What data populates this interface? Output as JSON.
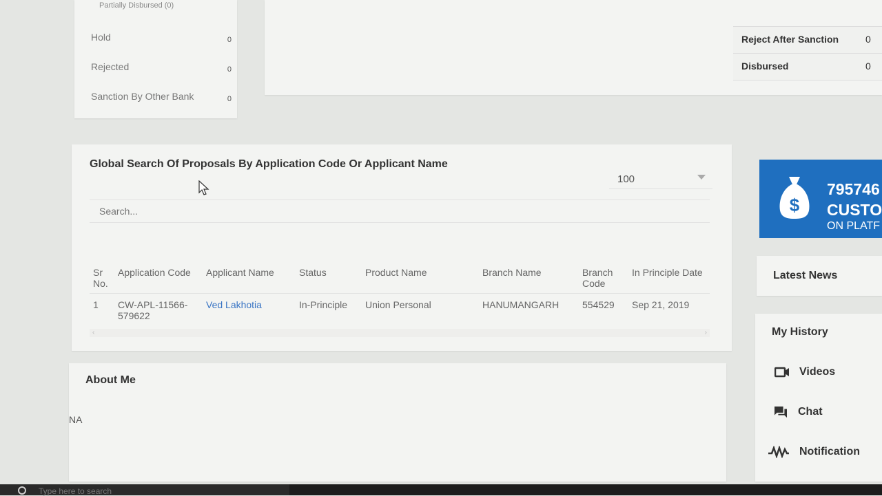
{
  "status_panel": {
    "partially_disbursed": "Partially Disbursed (0)",
    "items": [
      {
        "label": "Hold",
        "count": "0"
      },
      {
        "label": "Rejected",
        "count": "0"
      },
      {
        "label": "Sanction By Other Bank",
        "count": "0"
      }
    ]
  },
  "right_panel": {
    "rows": [
      {
        "label": "Reject After Sanction",
        "value": "0"
      },
      {
        "label": "Disbursed",
        "value": "0"
      }
    ]
  },
  "search_section": {
    "title": "Global Search Of Proposals By Application Code Or Applicant Name",
    "page_size": "100",
    "search_placeholder": "Search...",
    "columns": [
      "Sr No.",
      "Application Code",
      "Applicant Name",
      "Status",
      "Product Name",
      "Branch Name",
      "Branch Code",
      "In Principle Date"
    ],
    "rows": [
      {
        "sr": "1",
        "application_code": "CW-APL-11566-579622",
        "applicant_name": "Ved Lakhotia",
        "status": "In-Principle",
        "product_name": "Union Personal",
        "branch_name": "HANUMANGARH",
        "branch_code": "554529",
        "in_principle_date": "Sep 21, 2019"
      }
    ]
  },
  "about": {
    "title": "About Me",
    "body": "NA"
  },
  "banner": {
    "number": "795746",
    "line1": "CUSTO",
    "line2": "ON PLATF"
  },
  "sidebar": {
    "latest_news": "Latest News",
    "my_history": "My History",
    "items": [
      {
        "label": "Videos",
        "icon": "video-camera-icon"
      },
      {
        "label": "Chat",
        "icon": "chat-icon"
      },
      {
        "label": "Notification",
        "icon": "pulse-icon"
      }
    ]
  },
  "taskbar": {
    "search_placeholder": "Type here to search"
  },
  "colors": {
    "banner": "#1f6fbf",
    "link": "#3a75c4",
    "taskbar": "#1c1c1c"
  }
}
